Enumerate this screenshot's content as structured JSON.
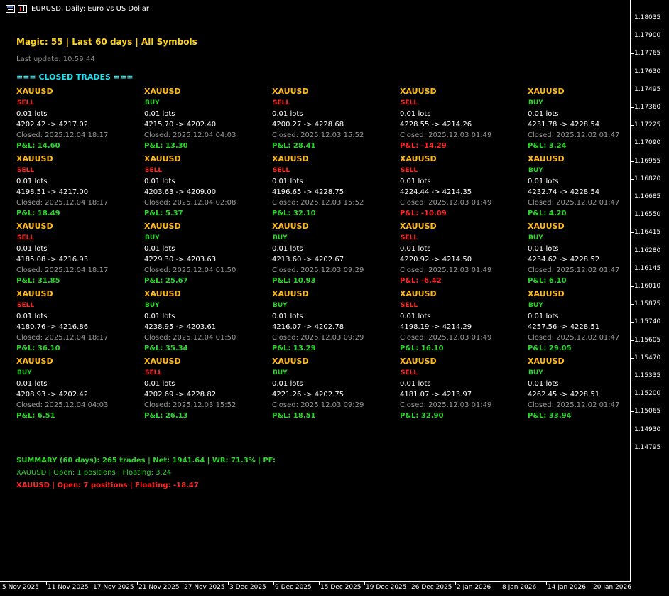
{
  "window": {
    "title": "EURUSD, Daily:  Euro vs US Dollar"
  },
  "header": {
    "line1": "Magic: 55 | Last 60 days | All Symbols",
    "line2": "Last update: 10:59:44",
    "section": "=== CLOSED TRADES ==="
  },
  "columns": [
    [
      {
        "symbol": "XAUUSD",
        "dir": "SELL",
        "lots": "0.01 lots",
        "price": "4202.42 -> 4217.02",
        "closed": "Closed: 2025.12.04 18:17",
        "pnl": "P&L: 14.60"
      },
      {
        "symbol": "XAUUSD",
        "dir": "SELL",
        "lots": "0.01 lots",
        "price": "4198.51 -> 4217.00",
        "closed": "Closed: 2025.12.04 18:17",
        "pnl": "P&L: 18.49"
      },
      {
        "symbol": "XAUUSD",
        "dir": "SELL",
        "lots": "0.01 lots",
        "price": "4185.08 -> 4216.93",
        "closed": "Closed: 2025.12.04 18:17",
        "pnl": "P&L: 31.85"
      },
      {
        "symbol": "XAUUSD",
        "dir": "SELL",
        "lots": "0.01 lots",
        "price": "4180.76 -> 4216.86",
        "closed": "Closed: 2025.12.04 18:17",
        "pnl": "P&L: 36.10"
      },
      {
        "symbol": "XAUUSD",
        "dir": "BUY",
        "lots": "0.01 lots",
        "price": "4208.93 -> 4202.42",
        "closed": "Closed: 2025.12.04 04:03",
        "pnl": "P&L: 6.51"
      }
    ],
    [
      {
        "symbol": "XAUUSD",
        "dir": "BUY",
        "lots": "0.01 lots",
        "price": "4215.70 -> 4202.40",
        "closed": "Closed: 2025.12.04 04:03",
        "pnl": "P&L: 13.30"
      },
      {
        "symbol": "XAUUSD",
        "dir": "SELL",
        "lots": "0.01 lots",
        "price": "4203.63 -> 4209.00",
        "closed": "Closed: 2025.12.04 02:08",
        "pnl": "P&L: 5.37"
      },
      {
        "symbol": "XAUUSD",
        "dir": "BUY",
        "lots": "0.01 lots",
        "price": "4229.30 -> 4203.63",
        "closed": "Closed: 2025.12.04 01:50",
        "pnl": "P&L: 25.67"
      },
      {
        "symbol": "XAUUSD",
        "dir": "BUY",
        "lots": "0.01 lots",
        "price": "4238.95 -> 4203.61",
        "closed": "Closed: 2025.12.04 01:50",
        "pnl": "P&L: 35.34"
      },
      {
        "symbol": "XAUUSD",
        "dir": "SELL",
        "lots": "0.01 lots",
        "price": "4202.69 -> 4228.82",
        "closed": "Closed: 2025.12.03 15:52",
        "pnl": "P&L: 26.13"
      }
    ],
    [
      {
        "symbol": "XAUUSD",
        "dir": "SELL",
        "lots": "0.01 lots",
        "price": "4200.27 -> 4228.68",
        "closed": "Closed: 2025.12.03 15:52",
        "pnl": "P&L: 28.41"
      },
      {
        "symbol": "XAUUSD",
        "dir": "SELL",
        "lots": "0.01 lots",
        "price": "4196.65 -> 4228.75",
        "closed": "Closed: 2025.12.03 15:52",
        "pnl": "P&L: 32.10"
      },
      {
        "symbol": "XAUUSD",
        "dir": "BUY",
        "lots": "0.01 lots",
        "price": "4213.60 -> 4202.67",
        "closed": "Closed: 2025.12.03 09:29",
        "pnl": "P&L: 10.93"
      },
      {
        "symbol": "XAUUSD",
        "dir": "BUY",
        "lots": "0.01 lots",
        "price": "4216.07 -> 4202.78",
        "closed": "Closed: 2025.12.03 09:29",
        "pnl": "P&L: 13.29"
      },
      {
        "symbol": "XAUUSD",
        "dir": "BUY",
        "lots": "0.01 lots",
        "price": "4221.26 -> 4202.75",
        "closed": "Closed: 2025.12.03 09:29",
        "pnl": "P&L: 18.51"
      }
    ],
    [
      {
        "symbol": "XAUUSD",
        "dir": "SELL",
        "lots": "0.01 lots",
        "price": "4228.55 -> 4214.26",
        "closed": "Closed: 2025.12.03 01:49",
        "pnl": "P&L: -14.29"
      },
      {
        "symbol": "XAUUSD",
        "dir": "SELL",
        "lots": "0.01 lots",
        "price": "4224.44 -> 4214.35",
        "closed": "Closed: 2025.12.03 01:49",
        "pnl": "P&L: -10.09"
      },
      {
        "symbol": "XAUUSD",
        "dir": "SELL",
        "lots": "0.01 lots",
        "price": "4220.92 -> 4214.50",
        "closed": "Closed: 2025.12.03 01:49",
        "pnl": "P&L: -6.42"
      },
      {
        "symbol": "XAUUSD",
        "dir": "SELL",
        "lots": "0.01 lots",
        "price": "4198.19 -> 4214.29",
        "closed": "Closed: 2025.12.03 01:49",
        "pnl": "P&L: 16.10"
      },
      {
        "symbol": "XAUUSD",
        "dir": "SELL",
        "lots": "0.01 lots",
        "price": "4181.07 -> 4213.97",
        "closed": "Closed: 2025.12.03 01:49",
        "pnl": "P&L: 32.90"
      }
    ],
    [
      {
        "symbol": "XAUUSD",
        "dir": "BUY",
        "lots": "0.01 lots",
        "price": "4231.78 -> 4228.54",
        "closed": "Closed: 2025.12.02 01:47",
        "pnl": "P&L: 3.24"
      },
      {
        "symbol": "XAUUSD",
        "dir": "BUY",
        "lots": "0.01 lots",
        "price": "4232.74 -> 4228.54",
        "closed": "Closed: 2025.12.02 01:47",
        "pnl": "P&L: 4.20"
      },
      {
        "symbol": "XAUUSD",
        "dir": "BUY",
        "lots": "0.01 lots",
        "price": "4234.62 -> 4228.52",
        "closed": "Closed: 2025.12.02 01:47",
        "pnl": "P&L: 6.10"
      },
      {
        "symbol": "XAUUSD",
        "dir": "BUY",
        "lots": "0.01 lots",
        "price": "4257.56 -> 4228.51",
        "closed": "Closed: 2025.12.02 01:47",
        "pnl": "P&L: 29.05"
      },
      {
        "symbol": "XAUUSD",
        "dir": "BUY",
        "lots": "0.01 lots",
        "price": "4262.45 -> 4228.51",
        "closed": "Closed: 2025.12.02 01:47",
        "pnl": "P&L: 33.94"
      }
    ]
  ],
  "footer": {
    "summary": "SUMMARY (60 days): 265 trades | Net: 1941.64 | WR: 71.3% | PF:",
    "open1": "XAUUSD | Open: 1 positions | Floating: 3.24",
    "open2": "XAUUSD | Open: 7 positions | Floating: -18.47"
  },
  "price_axis": [
    "1.18035",
    "1.17900",
    "1.17765",
    "1.17630",
    "1.17495",
    "1.17360",
    "1.17225",
    "1.17090",
    "1.16955",
    "1.16820",
    "1.16685",
    "1.16550",
    "1.16415",
    "1.16280",
    "1.16145",
    "1.16010",
    "1.15875",
    "1.15740",
    "1.15605",
    "1.15470",
    "1.15335",
    "1.15200",
    "1.15065",
    "1.14930",
    "1.14795"
  ],
  "time_axis": [
    "5 Nov 2025",
    "11 Nov 2025",
    "17 Nov 2025",
    "21 Nov 2025",
    "27 Nov 2025",
    "3 Dec 2025",
    "9 Dec 2025",
    "15 Dec 2025",
    "19 Dec 2025",
    "26 Dec 2025",
    "2 Jan 2026",
    "8 Jan 2026",
    "14 Jan 2026",
    "20 Jan 2026"
  ],
  "colors": {
    "background": "#000000",
    "title_yellow": "#ffd21a",
    "symbol_orange": "#ffb91a",
    "section_cyan": "#1ee0ee",
    "positive_green": "#2cd52c",
    "negative_red": "#ff2626",
    "muted_gray": "#999999"
  }
}
